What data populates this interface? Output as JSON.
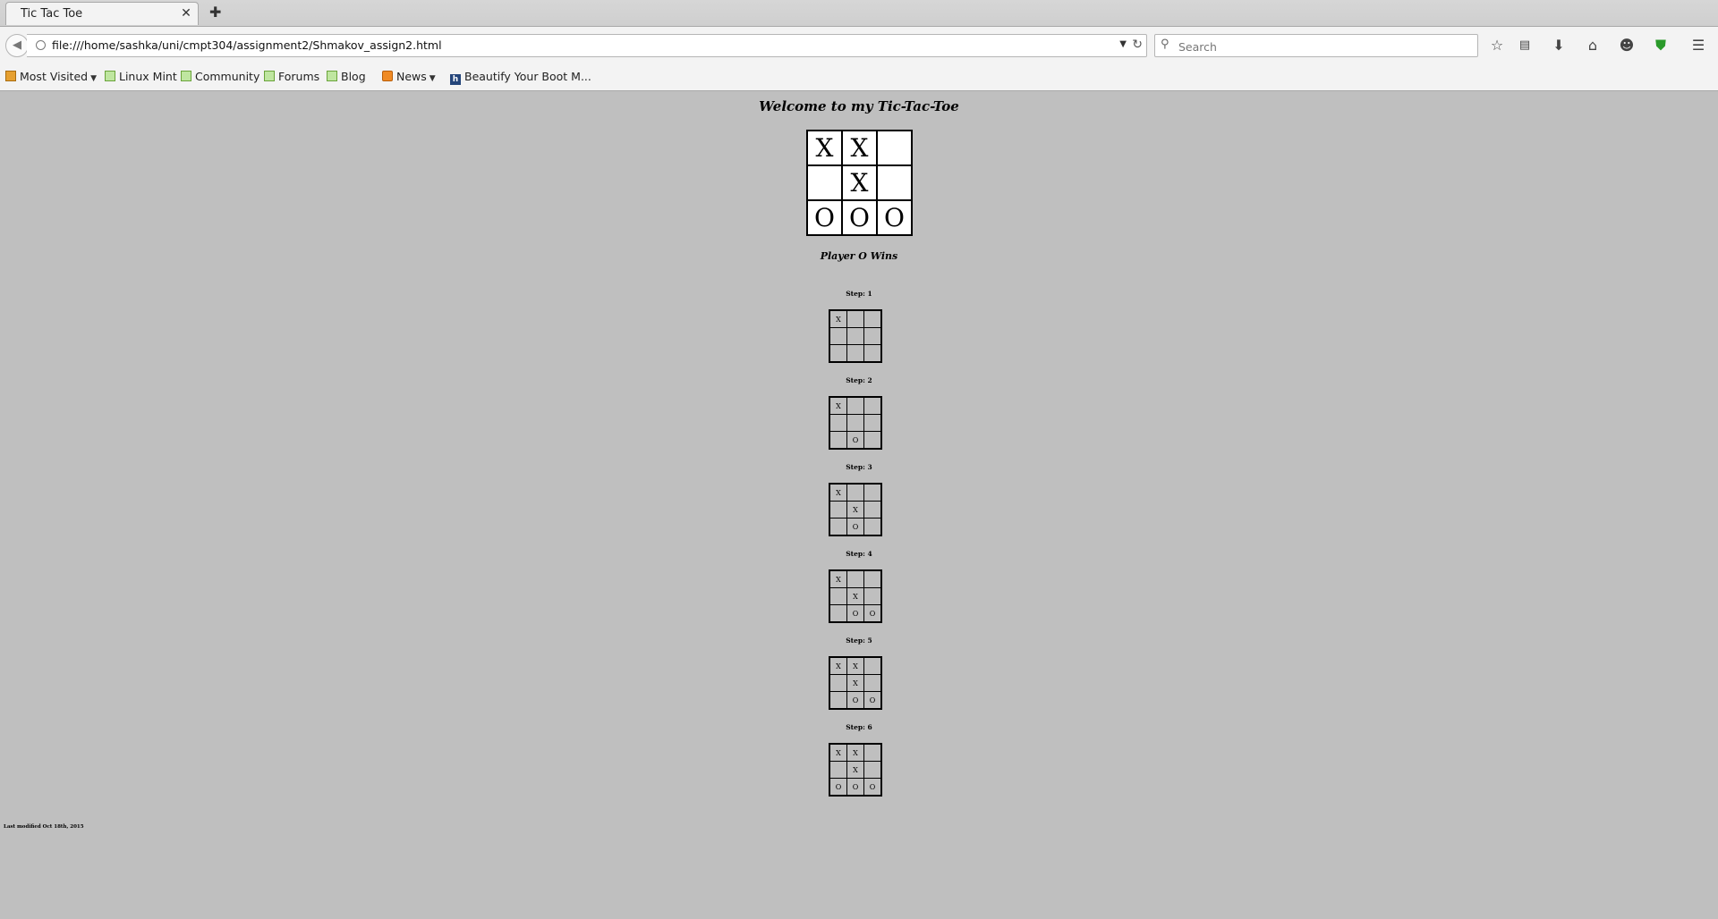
{
  "browser": {
    "tab_title": "Tic Tac Toe",
    "url": "file:///home/sashka/uni/cmpt304/assignment2/Shmakov_assign2.html",
    "search_placeholder": "Search",
    "bookmarks": [
      {
        "label": "Most Visited",
        "icon": "folder-icon",
        "dropdown": true
      },
      {
        "label": "Linux Mint",
        "icon": "mint-icon",
        "dropdown": false
      },
      {
        "label": "Community",
        "icon": "mint-icon",
        "dropdown": false
      },
      {
        "label": "Forums",
        "icon": "mint-icon",
        "dropdown": false
      },
      {
        "label": "Blog",
        "icon": "mint-icon",
        "dropdown": false
      },
      {
        "label": "News",
        "icon": "rss-icon",
        "dropdown": true
      },
      {
        "label": "Beautify Your Boot M...",
        "icon": "site-icon",
        "dropdown": false
      }
    ]
  },
  "page": {
    "title": "Welcome to my Tic-Tac-Toe",
    "board": [
      [
        "X",
        "X",
        ""
      ],
      [
        "",
        "X",
        ""
      ],
      [
        "O",
        "O",
        "O"
      ]
    ],
    "result": "Player O Wins",
    "steps": [
      {
        "label": "Step: 1",
        "board": [
          [
            "X",
            "",
            ""
          ],
          [
            "",
            "",
            ""
          ],
          [
            "",
            "",
            ""
          ]
        ]
      },
      {
        "label": "Step: 2",
        "board": [
          [
            "X",
            "",
            ""
          ],
          [
            "",
            "",
            ""
          ],
          [
            "",
            "O",
            ""
          ]
        ]
      },
      {
        "label": "Step: 3",
        "board": [
          [
            "X",
            "",
            ""
          ],
          [
            "",
            "X",
            ""
          ],
          [
            "",
            "O",
            ""
          ]
        ]
      },
      {
        "label": "Step: 4",
        "board": [
          [
            "X",
            "",
            ""
          ],
          [
            "",
            "X",
            ""
          ],
          [
            "",
            "O",
            "O"
          ]
        ]
      },
      {
        "label": "Step: 5",
        "board": [
          [
            "X",
            "X",
            ""
          ],
          [
            "",
            "X",
            ""
          ],
          [
            "",
            "O",
            "O"
          ]
        ]
      },
      {
        "label": "Step: 6",
        "board": [
          [
            "X",
            "X",
            ""
          ],
          [
            "",
            "X",
            ""
          ],
          [
            "O",
            "O",
            "O"
          ]
        ]
      }
    ],
    "footer": "Last modified Oct 18th, 2015"
  }
}
